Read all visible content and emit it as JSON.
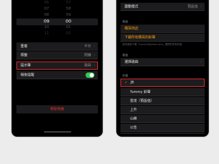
{
  "left_screen": {
    "picker": {
      "hours": [
        "06",
        "07",
        "08",
        "09",
        "10",
        "11"
      ],
      "minutes": [
        "57",
        "58",
        "59",
        "00",
        "01",
        "02"
      ],
      "selected_hour": "09",
      "selected_minute": "00"
    },
    "rows": [
      {
        "label": "重複",
        "value": "平日"
      },
      {
        "label": "標籤",
        "value": "鬧鐘"
      },
      {
        "label": "提示聲",
        "value": "歌曲"
      },
      {
        "label": "稍後提醒",
        "toggle_on": true
      }
    ],
    "delete_label": "刪除鬧鐘"
  },
  "right_screen": {
    "top_row": {
      "label": "震動模式",
      "value": "預設值"
    },
    "music_section_header": "歌曲",
    "buy_more_label": "購買商店",
    "download_all_label": "下載所有購買的鈴聲",
    "note": "將會重新下載「xxxxxx@gmail.com」購買的所有鈴聲",
    "songs_section_header": "歌曲",
    "pick_song_label": "選擇歌曲",
    "ringtones_header": "鈴聲",
    "ringtones": [
      {
        "label": "JB",
        "selected": true
      },
      {
        "label": "Yummy 鈴聲",
        "selected": false
      },
      {
        "label": "雷達（預設值）",
        "selected": false
      },
      {
        "label": "上升",
        "selected": false
      },
      {
        "label": "山峰",
        "selected": false
      },
      {
        "label": "公告",
        "selected": false
      },
      {
        "label": "水晶",
        "selected": false
      }
    ]
  },
  "colors": {
    "accent": "#ff9f0a",
    "highlight_box": "#e0282f",
    "toggle_on": "#34c759"
  }
}
